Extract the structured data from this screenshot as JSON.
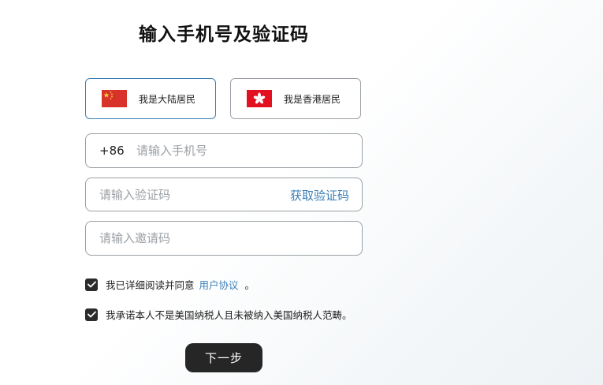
{
  "page": {
    "title": "输入手机号及验证码"
  },
  "regions": [
    {
      "label": "我是大陆居民",
      "selected": true
    },
    {
      "label": "我是香港居民",
      "selected": false
    }
  ],
  "phone": {
    "country_code": "+86",
    "placeholder": "请输入手机号",
    "value": ""
  },
  "verification": {
    "placeholder": "请输入验证码",
    "value": "",
    "get_code_label": "获取验证码"
  },
  "invite": {
    "placeholder": "请输入邀请码",
    "value": ""
  },
  "agreements": {
    "terms": {
      "checked": true,
      "prefix": "我已详细阅读并同意",
      "link": "用户协议",
      "suffix": "。"
    },
    "tax": {
      "checked": true,
      "text": "我承诺本人不是美国纳税人且未被纳入美国纳税人范畴。"
    }
  },
  "next_button": {
    "label": "下一步"
  },
  "colors": {
    "accent": "#3b7fb6",
    "button": "#262626",
    "border": "#9aa0a6"
  }
}
